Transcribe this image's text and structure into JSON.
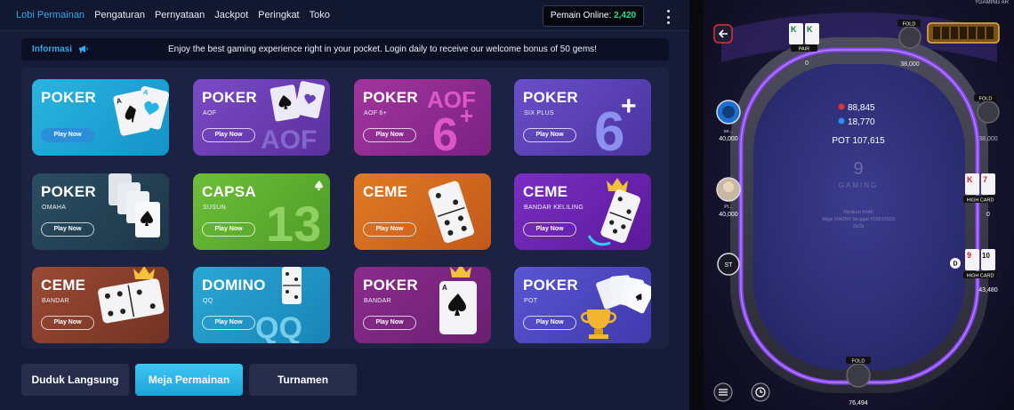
{
  "nav": {
    "items": [
      "Lobi Permainan",
      "Pengaturan",
      "Pernyataan",
      "Jackpot",
      "Peringkat",
      "Toko"
    ],
    "active_index": 0,
    "online_label": "Pemain Online:",
    "online_count": "2,420"
  },
  "info": {
    "label": "Informasi",
    "message": "Enjoy the best gaming experience right in your pocket. Login daily to receive our welcome bonus of 50 gems!"
  },
  "games": [
    {
      "title": "POKER",
      "subtitle": "",
      "button": "Play Now",
      "art": "AQ",
      "theme": "blue"
    },
    {
      "title": "POKER",
      "subtitle": "AOF",
      "button": "Play Now",
      "art": "AOF",
      "theme": "purple"
    },
    {
      "title": "POKER",
      "subtitle": "AOF 6+",
      "button": "Play Now",
      "art": "AOF 6+",
      "theme": "magenta"
    },
    {
      "title": "POKER",
      "subtitle": "SIX PLUS",
      "button": "Play Now",
      "art": "6+",
      "theme": "indigo"
    },
    {
      "title": "POKER",
      "subtitle": "OMAHA",
      "button": "Play Now",
      "art": "",
      "theme": "teal"
    },
    {
      "title": "CAPSA",
      "subtitle": "SUSUN",
      "button": "Play Now",
      "art": "13",
      "theme": "green"
    },
    {
      "title": "CEME",
      "subtitle": "",
      "button": "Play Now",
      "art": "",
      "theme": "orange"
    },
    {
      "title": "CEME",
      "subtitle": "BANDAR KELILING",
      "button": "Play Now",
      "art": "",
      "theme": "violet"
    },
    {
      "title": "CEME",
      "subtitle": "BANDAR",
      "button": "Play Now",
      "art": "",
      "theme": "brown"
    },
    {
      "title": "DOMINO",
      "subtitle": "QQ",
      "button": "Play Now",
      "art": "QQ",
      "theme": "cyan"
    },
    {
      "title": "POKER",
      "subtitle": "BANDAR",
      "button": "Play Now",
      "art": "",
      "theme": "plum"
    },
    {
      "title": "POKER",
      "subtitle": "POT",
      "button": "Play Now",
      "art": "",
      "theme": "royal"
    }
  ],
  "tabs": [
    "Duduk Langsung",
    "Meja Permainan",
    "Turnamen"
  ],
  "active_tab": 1,
  "table": {
    "title": "YGAMING AR",
    "pot_chips_1": "88,845",
    "pot_chips_2": "18,770",
    "pot_label": "POT 107,615",
    "logo_text": "GAMING",
    "info_line1": "Medium #046",
    "info_line2": "Meja #04250 Tanggal #16810503",
    "info_line3": "1k/2k",
    "seats": [
      {
        "pos": "top-left",
        "name": "",
        "stack": "0",
        "tag": "PAIR",
        "cards": [
          "K",
          "K"
        ]
      },
      {
        "pos": "top-right",
        "name": "",
        "stack": "38,000",
        "tag": "FOLD",
        "cards": []
      },
      {
        "pos": "left-1",
        "name": "se...",
        "stack": "40,000",
        "tag": "",
        "cards": []
      },
      {
        "pos": "right-1",
        "name": "",
        "stack": "38,000",
        "tag": "FOLD",
        "cards": []
      },
      {
        "pos": "left-2",
        "name": "Pi...",
        "stack": "40,000",
        "tag": "",
        "cards": []
      },
      {
        "pos": "right-2",
        "name": "",
        "stack": "0",
        "tag": "HIGH CARD",
        "cards": [
          "K",
          "7"
        ]
      },
      {
        "pos": "right-3",
        "name": "",
        "stack": "43,480",
        "tag": "HIGH CARD",
        "cards": [
          "9",
          "10"
        ]
      },
      {
        "pos": "bottom",
        "name": "",
        "stack": "76,494",
        "tag": "FOLD",
        "cards": []
      }
    ],
    "sit_label": "ST",
    "dealer_label": "D"
  },
  "colors": {
    "accent": "#3aa7e6",
    "online_green": "#22e08a",
    "tab_active": "#1ea3d8",
    "table_rail": "#7a3cf0"
  }
}
